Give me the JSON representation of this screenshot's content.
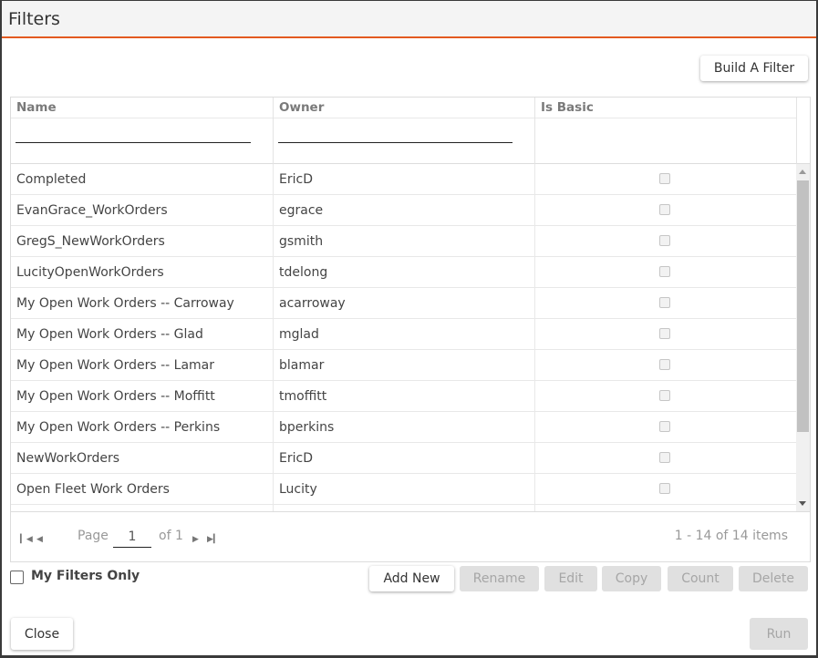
{
  "dialog": {
    "title": "Filters"
  },
  "toolbar": {
    "build_filter_label": "Build A Filter"
  },
  "grid": {
    "columns": [
      {
        "label": "Name",
        "filter_value": ""
      },
      {
        "label": "Owner",
        "filter_value": ""
      },
      {
        "label": "Is Basic"
      }
    ],
    "rows": [
      {
        "name": "Completed",
        "owner": "EricD",
        "is_basic": false
      },
      {
        "name": "EvanGrace_WorkOrders",
        "owner": "egrace",
        "is_basic": false
      },
      {
        "name": "GregS_NewWorkOrders",
        "owner": "gsmith",
        "is_basic": false
      },
      {
        "name": "LucityOpenWorkOrders",
        "owner": "tdelong",
        "is_basic": false
      },
      {
        "name": "My Open Work Orders -- Carroway",
        "owner": "acarroway",
        "is_basic": false
      },
      {
        "name": "My Open Work Orders -- Glad",
        "owner": "mglad",
        "is_basic": false
      },
      {
        "name": "My Open Work Orders -- Lamar",
        "owner": "blamar",
        "is_basic": false
      },
      {
        "name": "My Open Work Orders -- Moffitt",
        "owner": "tmoffitt",
        "is_basic": false
      },
      {
        "name": "My Open Work Orders -- Perkins",
        "owner": "bperkins",
        "is_basic": false
      },
      {
        "name": "NewWorkOrders",
        "owner": "EricD",
        "is_basic": false
      },
      {
        "name": "Open Fleet Work Orders",
        "owner": "Lucity",
        "is_basic": false
      },
      {
        "name": "",
        "owner": "",
        "is_basic": false
      }
    ],
    "pager": {
      "page_label": "Page",
      "page_value": "1",
      "of_label": "of 1",
      "summary": "1 - 14 of 14 items",
      "icons": [
        "first-page-icon",
        "prev-page-icon",
        "next-page-icon",
        "last-page-icon"
      ]
    }
  },
  "options": {
    "my_filters_only_label": "My Filters Only",
    "my_filters_only_checked": false
  },
  "actions": {
    "add_new": "Add New",
    "rename": "Rename",
    "edit": "Edit",
    "copy": "Copy",
    "count": "Count",
    "delete": "Delete"
  },
  "footer": {
    "close": "Close",
    "run": "Run"
  },
  "colors": {
    "accent": "#e35a20",
    "disabled_bg": "#e0e0e0",
    "disabled_text": "#a6a6a6"
  }
}
